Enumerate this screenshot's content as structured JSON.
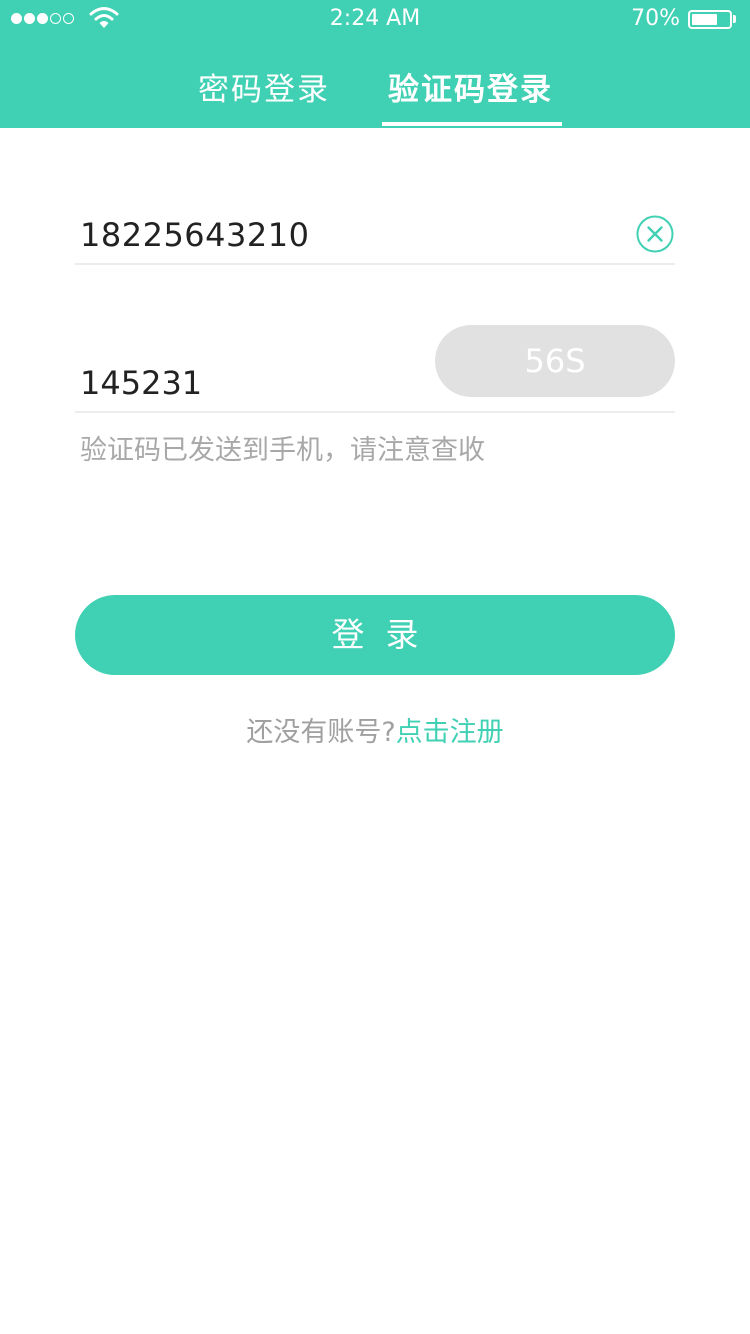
{
  "status_bar": {
    "time": "2:24 AM",
    "battery_percent": "70%",
    "battery_level": 0.7,
    "signal_bars_filled": 3,
    "signal_bars_total": 5
  },
  "tabs": [
    {
      "label": "密码登录",
      "active": false
    },
    {
      "label": "验证码登录",
      "active": true
    }
  ],
  "form": {
    "phone_value": "18225643210",
    "code_value": "145231",
    "countdown_label": "56S",
    "hint": "验证码已发送到手机，请注意查收"
  },
  "login_button_label": "登  录",
  "register": {
    "prompt": "还没有账号?",
    "link": "点击注册"
  },
  "colors": {
    "accent": "#40d0b3",
    "disabled_button": "#e1e1e1",
    "muted_text": "#a8a8a8"
  },
  "icons": {
    "clear": "close-circle-icon",
    "wifi": "wifi-icon",
    "battery": "battery-icon"
  }
}
